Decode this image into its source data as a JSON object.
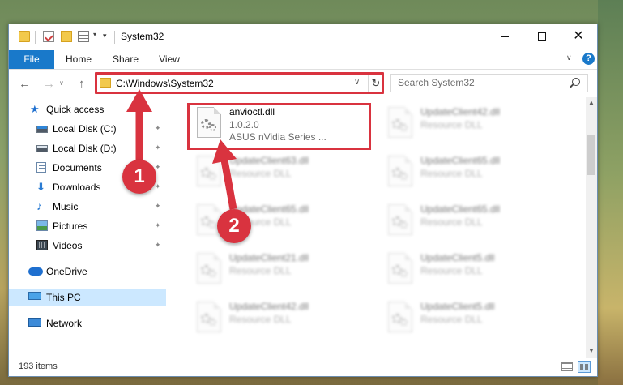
{
  "window": {
    "title": "System32",
    "controls": {
      "minimize": "minimize",
      "maximize": "maximize",
      "close": "✕"
    }
  },
  "quick_access_toolbar": {
    "dropdown_glyph": "▾",
    "customize_glyph": "▾"
  },
  "ribbon": {
    "tabs": [
      {
        "label": "File",
        "active": true
      },
      {
        "label": "Home"
      },
      {
        "label": "Share"
      },
      {
        "label": "View"
      }
    ],
    "collapse_glyph": "∨",
    "help_label": "?"
  },
  "navigation": {
    "back_glyph": "←",
    "forward_glyph": "→",
    "history_glyph": "∨",
    "up_glyph": "↑"
  },
  "address_bar": {
    "path": "C:\\Windows\\System32",
    "dropdown_glyph": "∨",
    "refresh_glyph": "↻"
  },
  "search": {
    "placeholder": "Search System32"
  },
  "nav_pane": {
    "items": [
      {
        "label": "Quick access",
        "icon": "star-icon",
        "pinned": false
      },
      {
        "label": "Local Disk (C:)",
        "icon": "drive-icon",
        "pinned": true
      },
      {
        "label": "Local Disk (D:)",
        "icon": "drive-icon",
        "pinned": true
      },
      {
        "label": "Documents",
        "icon": "documents-icon",
        "pinned": true
      },
      {
        "label": "Downloads",
        "icon": "downloads-icon",
        "pinned": true
      },
      {
        "label": "Music",
        "icon": "music-icon",
        "pinned": true
      },
      {
        "label": "Pictures",
        "icon": "pictures-icon",
        "pinned": true
      },
      {
        "label": "Videos",
        "icon": "videos-icon",
        "pinned": true
      },
      {
        "label": "OneDrive",
        "icon": "onedrive-icon"
      },
      {
        "label": "This PC",
        "icon": "this-pc-icon",
        "selected": true
      },
      {
        "label": "Network",
        "icon": "network-icon"
      }
    ],
    "pin_glyph": "📌"
  },
  "files": {
    "items": [
      {
        "name": "anvioctl.dll",
        "line2": "1.0.2.0",
        "line3": "ASUS nVidia Series ...",
        "highlighted": true
      },
      {
        "name": "UpdateClient42.dll",
        "line2": "Resource DLL",
        "blurred": true
      },
      {
        "name": "UpdateClient63.dll",
        "line2": "Resource DLL",
        "blurred": true
      },
      {
        "name": "UpdateClient65.dll",
        "line2": "Resource DLL",
        "blurred": true
      },
      {
        "name": "UpdateClient65.dll",
        "line2": "Resource DLL",
        "blurred": true
      },
      {
        "name": "UpdateClient65.dll",
        "line2": "Resource DLL",
        "blurred": true
      },
      {
        "name": "UpdateClient21.dll",
        "line2": "Resource DLL",
        "blurred": true
      },
      {
        "name": "UpdateClient5.dll",
        "line2": "Resource DLL",
        "blurred": true
      },
      {
        "name": "UpdateClient42.dll",
        "line2": "Resource DLL",
        "blurred": true
      },
      {
        "name": "UpdateClient5.dll",
        "line2": "Resource DLL",
        "blurred": true
      }
    ]
  },
  "status_bar": {
    "item_count": "193 items"
  },
  "annotations": {
    "steps": [
      "1",
      "2"
    ],
    "color": "#d9333f"
  },
  "colors": {
    "accent": "#1979ca",
    "selection": "#cce8ff",
    "highlight": "#d9333f"
  }
}
